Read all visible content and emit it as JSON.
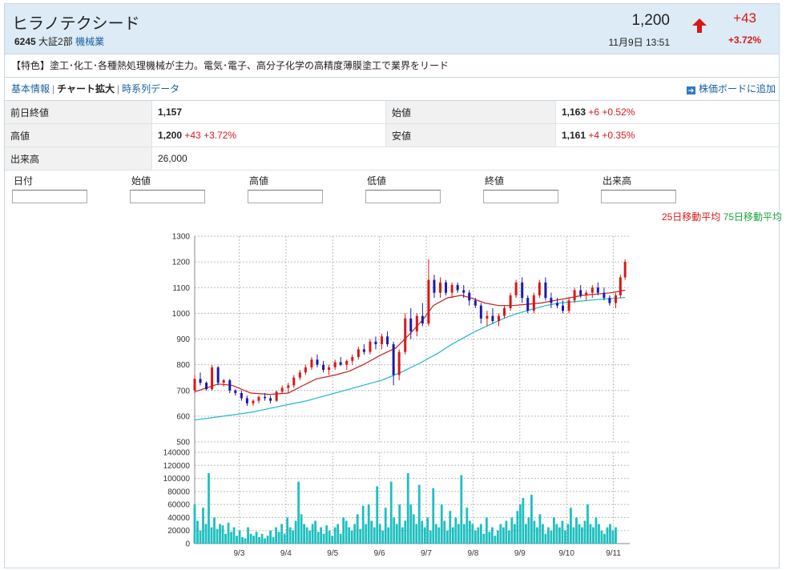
{
  "stock": {
    "name": "ヒラノテクシード",
    "code": "6245",
    "market": "大証2部",
    "sector": "機械業",
    "price": "1,200",
    "change": "+43",
    "change_pct": "+3.72%",
    "datetime": "11月9日 13:51"
  },
  "feature": "【特色】塗工･化工･各種熱処理機械が主力。電気･電子、高分子化学の高精度薄膜塗工で業界をリード",
  "tabs": {
    "basic": "基本情報",
    "chart": "チャート拡大",
    "series": "時系列データ",
    "add_board": "株価ボードに追加"
  },
  "quote": {
    "prev_close_label": "前日終値",
    "prev_close": "1,157",
    "open_label": "始値",
    "open": "1,163",
    "open_chg": "+6 +0.52%",
    "high_label": "高値",
    "high": "1,200",
    "high_chg": "+43 +3.72%",
    "low_label": "安値",
    "low": "1,161",
    "low_chg": "+4 +0.35%",
    "volume_label": "出来高",
    "volume": "26,000"
  },
  "inputs": {
    "date": "日付",
    "open": "始値",
    "high": "高値",
    "low": "低値",
    "close": "終値",
    "volume": "出来高"
  },
  "legend": {
    "ma25": "25日移動平均",
    "ma75": "75日移動平均"
  },
  "colors": {
    "up": "#d71818",
    "down": "#1a1aaa",
    "ma25": "#c81e1e",
    "ma75": "#20b4cc",
    "volume": "#1fbfbf",
    "grid": "#bbbbbb"
  },
  "chart_data": [
    {
      "type": "line",
      "title": "",
      "ylim": [
        500,
        1300
      ],
      "yticks": [
        500,
        600,
        700,
        800,
        900,
        1000,
        1100,
        1200,
        1300
      ],
      "xticks": [
        "9/3",
        "9/4",
        "9/5",
        "9/6",
        "9/7",
        "9/8",
        "9/9",
        "9/10",
        "9/11"
      ],
      "xrange": [
        0,
        9.3
      ],
      "grid": true,
      "legend_position": "top-right",
      "series": [
        {
          "name": "25日移動平均",
          "points": [
            [
              0,
              695
            ],
            [
              0.5,
              725
            ],
            [
              0.8,
              720
            ],
            [
              1.2,
              690
            ],
            [
              1.6,
              685
            ],
            [
              2,
              690
            ],
            [
              2.3,
              718
            ],
            [
              2.6,
              745
            ],
            [
              3,
              760
            ],
            [
              3.3,
              775
            ],
            [
              3.6,
              800
            ],
            [
              4,
              840
            ],
            [
              4.3,
              865
            ],
            [
              4.6,
              920
            ],
            [
              4.9,
              980
            ],
            [
              5.1,
              1030
            ],
            [
              5.4,
              1060
            ],
            [
              5.7,
              1070
            ],
            [
              5.9,
              1060
            ],
            [
              6.2,
              1040
            ],
            [
              6.5,
              1030
            ],
            [
              6.8,
              1030
            ],
            [
              7.1,
              1035
            ],
            [
              7.4,
              1040
            ],
            [
              7.7,
              1050
            ],
            [
              8,
              1060
            ],
            [
              8.3,
              1070
            ],
            [
              8.6,
              1075
            ],
            [
              8.9,
              1080
            ],
            [
              9.2,
              1090
            ]
          ]
        },
        {
          "name": "75日移動平均",
          "points": [
            [
              0,
              585
            ],
            [
              0.4,
              595
            ],
            [
              0.8,
              605
            ],
            [
              1.2,
              615
            ],
            [
              1.6,
              630
            ],
            [
              2,
              645
            ],
            [
              2.4,
              660
            ],
            [
              2.8,
              680
            ],
            [
              3.2,
              700
            ],
            [
              3.6,
              720
            ],
            [
              4,
              740
            ],
            [
              4.4,
              770
            ],
            [
              4.8,
              805
            ],
            [
              5.2,
              845
            ],
            [
              5.5,
              880
            ],
            [
              5.8,
              910
            ],
            [
              6,
              930
            ],
            [
              6.3,
              955
            ],
            [
              6.6,
              980
            ],
            [
              6.9,
              1000
            ],
            [
              7.2,
              1015
            ],
            [
              7.5,
              1030
            ],
            [
              7.8,
              1040
            ],
            [
              8.1,
              1045
            ],
            [
              8.4,
              1050
            ],
            [
              8.7,
              1055
            ],
            [
              9,
              1058
            ],
            [
              9.2,
              1062
            ]
          ]
        }
      ],
      "candles_note": "daily OHLC approximations (x in days from 9/2, open, high, low, close)",
      "candles": [
        [
          0.0,
          700,
          760,
          690,
          745
        ],
        [
          0.12,
          745,
          770,
          720,
          730
        ],
        [
          0.25,
          730,
          735,
          700,
          705
        ],
        [
          0.37,
          705,
          800,
          700,
          790
        ],
        [
          0.5,
          790,
          795,
          720,
          730
        ],
        [
          0.62,
          730,
          745,
          715,
          740
        ],
        [
          0.75,
          740,
          745,
          690,
          700
        ],
        [
          0.87,
          700,
          705,
          680,
          690
        ],
        [
          1.0,
          690,
          700,
          660,
          670
        ],
        [
          1.12,
          670,
          680,
          640,
          650
        ],
        [
          1.25,
          650,
          665,
          640,
          660
        ],
        [
          1.37,
          660,
          680,
          650,
          675
        ],
        [
          1.5,
          675,
          690,
          660,
          670
        ],
        [
          1.62,
          670,
          680,
          650,
          660
        ],
        [
          1.75,
          660,
          700,
          655,
          695
        ],
        [
          1.87,
          695,
          720,
          690,
          710
        ],
        [
          2.0,
          710,
          730,
          690,
          720
        ],
        [
          2.12,
          720,
          760,
          710,
          750
        ],
        [
          2.25,
          750,
          780,
          740,
          770
        ],
        [
          2.37,
          770,
          800,
          760,
          790
        ],
        [
          2.5,
          790,
          830,
          780,
          820
        ],
        [
          2.62,
          820,
          840,
          790,
          800
        ],
        [
          2.75,
          800,
          815,
          770,
          780
        ],
        [
          2.87,
          780,
          800,
          760,
          790
        ],
        [
          3.0,
          790,
          820,
          780,
          810
        ],
        [
          3.12,
          810,
          830,
          795,
          800
        ],
        [
          3.25,
          800,
          820,
          780,
          815
        ],
        [
          3.37,
          815,
          840,
          800,
          830
        ],
        [
          3.5,
          830,
          870,
          820,
          860
        ],
        [
          3.62,
          860,
          880,
          840,
          850
        ],
        [
          3.75,
          850,
          900,
          840,
          890
        ],
        [
          3.87,
          890,
          910,
          860,
          880
        ],
        [
          4.0,
          880,
          920,
          860,
          910
        ],
        [
          4.12,
          910,
          930,
          870,
          880
        ],
        [
          4.25,
          880,
          890,
          720,
          760
        ],
        [
          4.37,
          760,
          860,
          740,
          850
        ],
        [
          4.5,
          850,
          1000,
          840,
          980
        ],
        [
          4.62,
          980,
          1020,
          900,
          930
        ],
        [
          4.75,
          930,
          1000,
          910,
          990
        ],
        [
          4.87,
          990,
          1040,
          950,
          960
        ],
        [
          5.0,
          960,
          1210,
          950,
          1130
        ],
        [
          5.12,
          1130,
          1150,
          1060,
          1080
        ],
        [
          5.25,
          1080,
          1140,
          1060,
          1120
        ],
        [
          5.37,
          1120,
          1130,
          1070,
          1080
        ],
        [
          5.5,
          1080,
          1120,
          1060,
          1110
        ],
        [
          5.62,
          1110,
          1120,
          1080,
          1090
        ],
        [
          5.75,
          1090,
          1110,
          1060,
          1080
        ],
        [
          5.87,
          1080,
          1090,
          1030,
          1050
        ],
        [
          6.0,
          1050,
          1060,
          1020,
          1030
        ],
        [
          6.12,
          1030,
          1040,
          960,
          980
        ],
        [
          6.25,
          980,
          1010,
          950,
          990
        ],
        [
          6.37,
          990,
          1020,
          960,
          970
        ],
        [
          6.5,
          970,
          1000,
          950,
          990
        ],
        [
          6.62,
          990,
          1030,
          980,
          1020
        ],
        [
          6.75,
          1020,
          1080,
          1010,
          1070
        ],
        [
          6.87,
          1070,
          1130,
          1060,
          1120
        ],
        [
          7.0,
          1120,
          1140,
          1040,
          1060
        ],
        [
          7.12,
          1060,
          1070,
          1000,
          1010
        ],
        [
          7.25,
          1010,
          1080,
          1000,
          1070
        ],
        [
          7.37,
          1070,
          1130,
          1060,
          1120
        ],
        [
          7.5,
          1120,
          1140,
          1050,
          1060
        ],
        [
          7.62,
          1060,
          1080,
          1020,
          1040
        ],
        [
          7.75,
          1040,
          1060,
          1020,
          1030
        ],
        [
          7.87,
          1030,
          1050,
          1000,
          1010
        ],
        [
          8.0,
          1010,
          1060,
          1000,
          1050
        ],
        [
          8.12,
          1050,
          1100,
          1040,
          1090
        ],
        [
          8.25,
          1090,
          1110,
          1060,
          1070
        ],
        [
          8.37,
          1070,
          1090,
          1050,
          1080
        ],
        [
          8.5,
          1080,
          1110,
          1060,
          1100
        ],
        [
          8.62,
          1100,
          1120,
          1070,
          1080
        ],
        [
          8.75,
          1080,
          1100,
          1050,
          1060
        ],
        [
          8.87,
          1060,
          1070,
          1030,
          1040
        ],
        [
          9.0,
          1040,
          1080,
          1020,
          1070
        ],
        [
          9.1,
          1070,
          1150,
          1060,
          1140
        ],
        [
          9.2,
          1140,
          1210,
          1130,
          1200
        ]
      ]
    },
    {
      "type": "bar",
      "title": "",
      "ylim": [
        0,
        140000
      ],
      "yticks": [
        0,
        20000,
        40000,
        60000,
        80000,
        100000,
        120000,
        140000
      ],
      "xticks": [
        "9/3",
        "9/4",
        "9/5",
        "9/6",
        "9/7",
        "9/8",
        "9/9",
        "9/10",
        "9/11"
      ],
      "xrange": [
        0,
        9.3
      ],
      "grid": true,
      "x": [
        0.0,
        0.06,
        0.12,
        0.18,
        0.24,
        0.3,
        0.36,
        0.42,
        0.48,
        0.54,
        0.6,
        0.66,
        0.72,
        0.78,
        0.84,
        0.9,
        0.96,
        1.02,
        1.08,
        1.14,
        1.2,
        1.26,
        1.32,
        1.38,
        1.44,
        1.5,
        1.56,
        1.62,
        1.68,
        1.74,
        1.8,
        1.86,
        1.92,
        1.98,
        2.04,
        2.1,
        2.16,
        2.22,
        2.28,
        2.34,
        2.4,
        2.46,
        2.52,
        2.58,
        2.64,
        2.7,
        2.76,
        2.82,
        2.88,
        2.94,
        3.0,
        3.06,
        3.12,
        3.18,
        3.24,
        3.3,
        3.36,
        3.42,
        3.48,
        3.54,
        3.6,
        3.66,
        3.72,
        3.78,
        3.84,
        3.9,
        3.96,
        4.02,
        4.08,
        4.14,
        4.2,
        4.26,
        4.32,
        4.38,
        4.44,
        4.5,
        4.56,
        4.62,
        4.68,
        4.74,
        4.8,
        4.86,
        4.92,
        4.98,
        5.04,
        5.1,
        5.16,
        5.22,
        5.28,
        5.34,
        5.4,
        5.46,
        5.52,
        5.58,
        5.64,
        5.7,
        5.76,
        5.82,
        5.88,
        5.94,
        6.0,
        6.06,
        6.12,
        6.18,
        6.24,
        6.3,
        6.36,
        6.42,
        6.48,
        6.54,
        6.6,
        6.66,
        6.72,
        6.78,
        6.84,
        6.9,
        6.96,
        7.02,
        7.08,
        7.14,
        7.2,
        7.26,
        7.32,
        7.38,
        7.44,
        7.5,
        7.56,
        7.62,
        7.68,
        7.74,
        7.8,
        7.86,
        7.92,
        7.98,
        8.04,
        8.1,
        8.16,
        8.22,
        8.28,
        8.34,
        8.4,
        8.46,
        8.52,
        8.58,
        8.64,
        8.7,
        8.76,
        8.82,
        8.88,
        8.94,
        9.0,
        9.06,
        9.12,
        9.18,
        9.24
      ],
      "values": [
        60000,
        35000,
        20000,
        55000,
        30000,
        108000,
        25000,
        40000,
        22000,
        30000,
        28000,
        15000,
        32000,
        18000,
        25000,
        12000,
        20000,
        10000,
        8000,
        25000,
        15000,
        12000,
        18000,
        10000,
        15000,
        8000,
        12000,
        20000,
        10000,
        25000,
        18000,
        30000,
        15000,
        40000,
        25000,
        20000,
        35000,
        95000,
        45000,
        30000,
        25000,
        20000,
        30000,
        35000,
        18000,
        25000,
        15000,
        28000,
        20000,
        12000,
        25000,
        30000,
        15000,
        40000,
        35000,
        25000,
        20000,
        30000,
        45000,
        22000,
        58000,
        30000,
        60000,
        35000,
        25000,
        88000,
        30000,
        20000,
        55000,
        25000,
        95000,
        40000,
        30000,
        60000,
        25000,
        35000,
        108000,
        60000,
        45000,
        30000,
        90000,
        35000,
        25000,
        40000,
        20000,
        85000,
        30000,
        25000,
        60000,
        35000,
        20000,
        50000,
        25000,
        40000,
        30000,
        105000,
        30000,
        55000,
        35000,
        30000,
        20000,
        25000,
        30000,
        15000,
        40000,
        18000,
        25000,
        12000,
        20000,
        30000,
        25000,
        35000,
        20000,
        40000,
        30000,
        50000,
        60000,
        70000,
        30000,
        40000,
        75000,
        35000,
        25000,
        45000,
        30000,
        15000,
        25000,
        20000,
        40000,
        30000,
        25000,
        35000,
        20000,
        30000,
        55000,
        25000,
        40000,
        30000,
        25000,
        35000,
        60000,
        30000,
        25000,
        40000,
        30000,
        20000,
        15000,
        25000,
        30000,
        20000,
        25000
      ]
    }
  ]
}
